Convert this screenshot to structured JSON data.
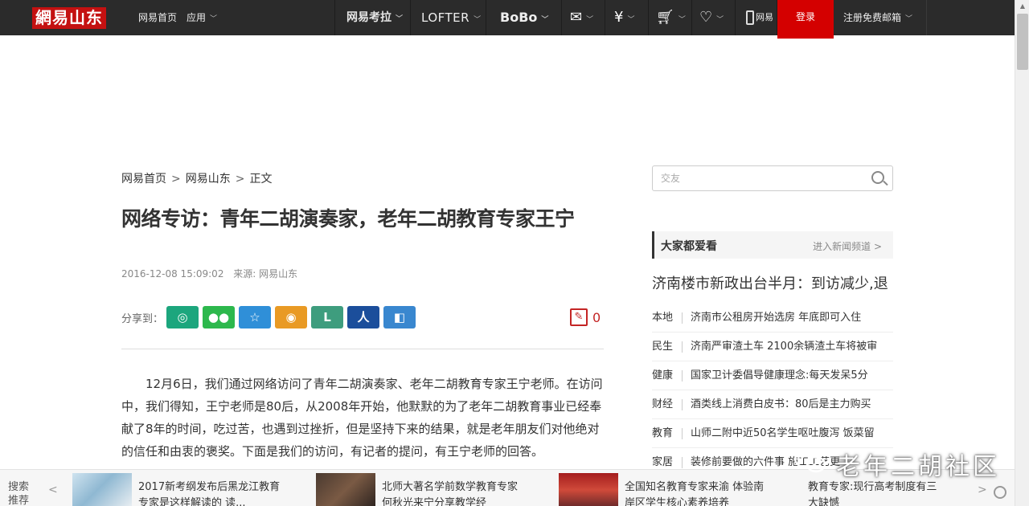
{
  "topbar": {
    "logo": "網易山东",
    "home": "网易首页",
    "apps": "应用",
    "kaola": "网易考拉",
    "lofter": "LOFTER",
    "bobo": "BoBo",
    "mobile_label": "网易",
    "login": "登录",
    "register": "注册免费邮箱"
  },
  "breadcrumb": [
    "网易首页",
    "网易山东",
    "正文"
  ],
  "article": {
    "title": "网络专访：青年二胡演奏家，老年二胡教育专家王宁",
    "date": "2016-12-08 15:09:02",
    "source": "来源: 网易山东",
    "share_label": "分享到：",
    "comment_count": "0",
    "body": "12月6日，我们通过网络访问了青年二胡演奏家、老年二胡教育专家王宁老师。在访问中，我们得知，王宁老师是80后，从2008年开始，他默默的为了老年二胡教育事业已经奉献了8年的时间，吃过苦，也遇到过挫折，但是坚持下来的结果，就是老年朋友们对他绝对的信任和由衷的褒奖。下面是我们的访问，有记者的提问，有王宁老师的回答。"
  },
  "sidebar": {
    "search_placeholder": "交友",
    "popular_title": "大家都爱看",
    "popular_more": "进入新闻频道 >",
    "headline": "济南楼市新政出台半月：到访减少,退",
    "items": [
      {
        "cat": "本地",
        "text": "济南市公租房开始选房 年底即可入住"
      },
      {
        "cat": "民生",
        "text": "济南严审渣土车 2100余辆渣土车将被审"
      },
      {
        "cat": "健康",
        "text": "国家卫计委倡导健康理念:每天发呆5分"
      },
      {
        "cat": "财经",
        "text": "酒类线上消费白皮书：80后是主力购买"
      },
      {
        "cat": "教育",
        "text": "山师二附中近50名学生呕吐腹泻 饭菜留"
      },
      {
        "cat": "家居",
        "text": "装修前要做的六件事 施工工艺更"
      }
    ]
  },
  "recommend": {
    "label": "搜索推荐",
    "items": [
      "2017新考纲发布后黑龙江教育专家是这样解读的 读...",
      "北师大著名学前数学教育专家何秋光来宁分享教学经",
      "全国知名教育专家来渝 体验南岸区学生核心素养培养",
      "教育专家:现行高考制度有三大缺憾"
    ]
  },
  "watermark": "老年二胡社区",
  "colors": {
    "topbar": "#2b2b2b",
    "login_bg": "#d40000",
    "share_qzone": "#1ca67d",
    "share_wechat": "#2db84d",
    "share_favorite": "#2f8fd8",
    "share_weibo": "#e99a24",
    "share_lofter": "#3e9d7e",
    "share_renren": "#1b4e9b",
    "share_yixin": "#3987cf"
  }
}
